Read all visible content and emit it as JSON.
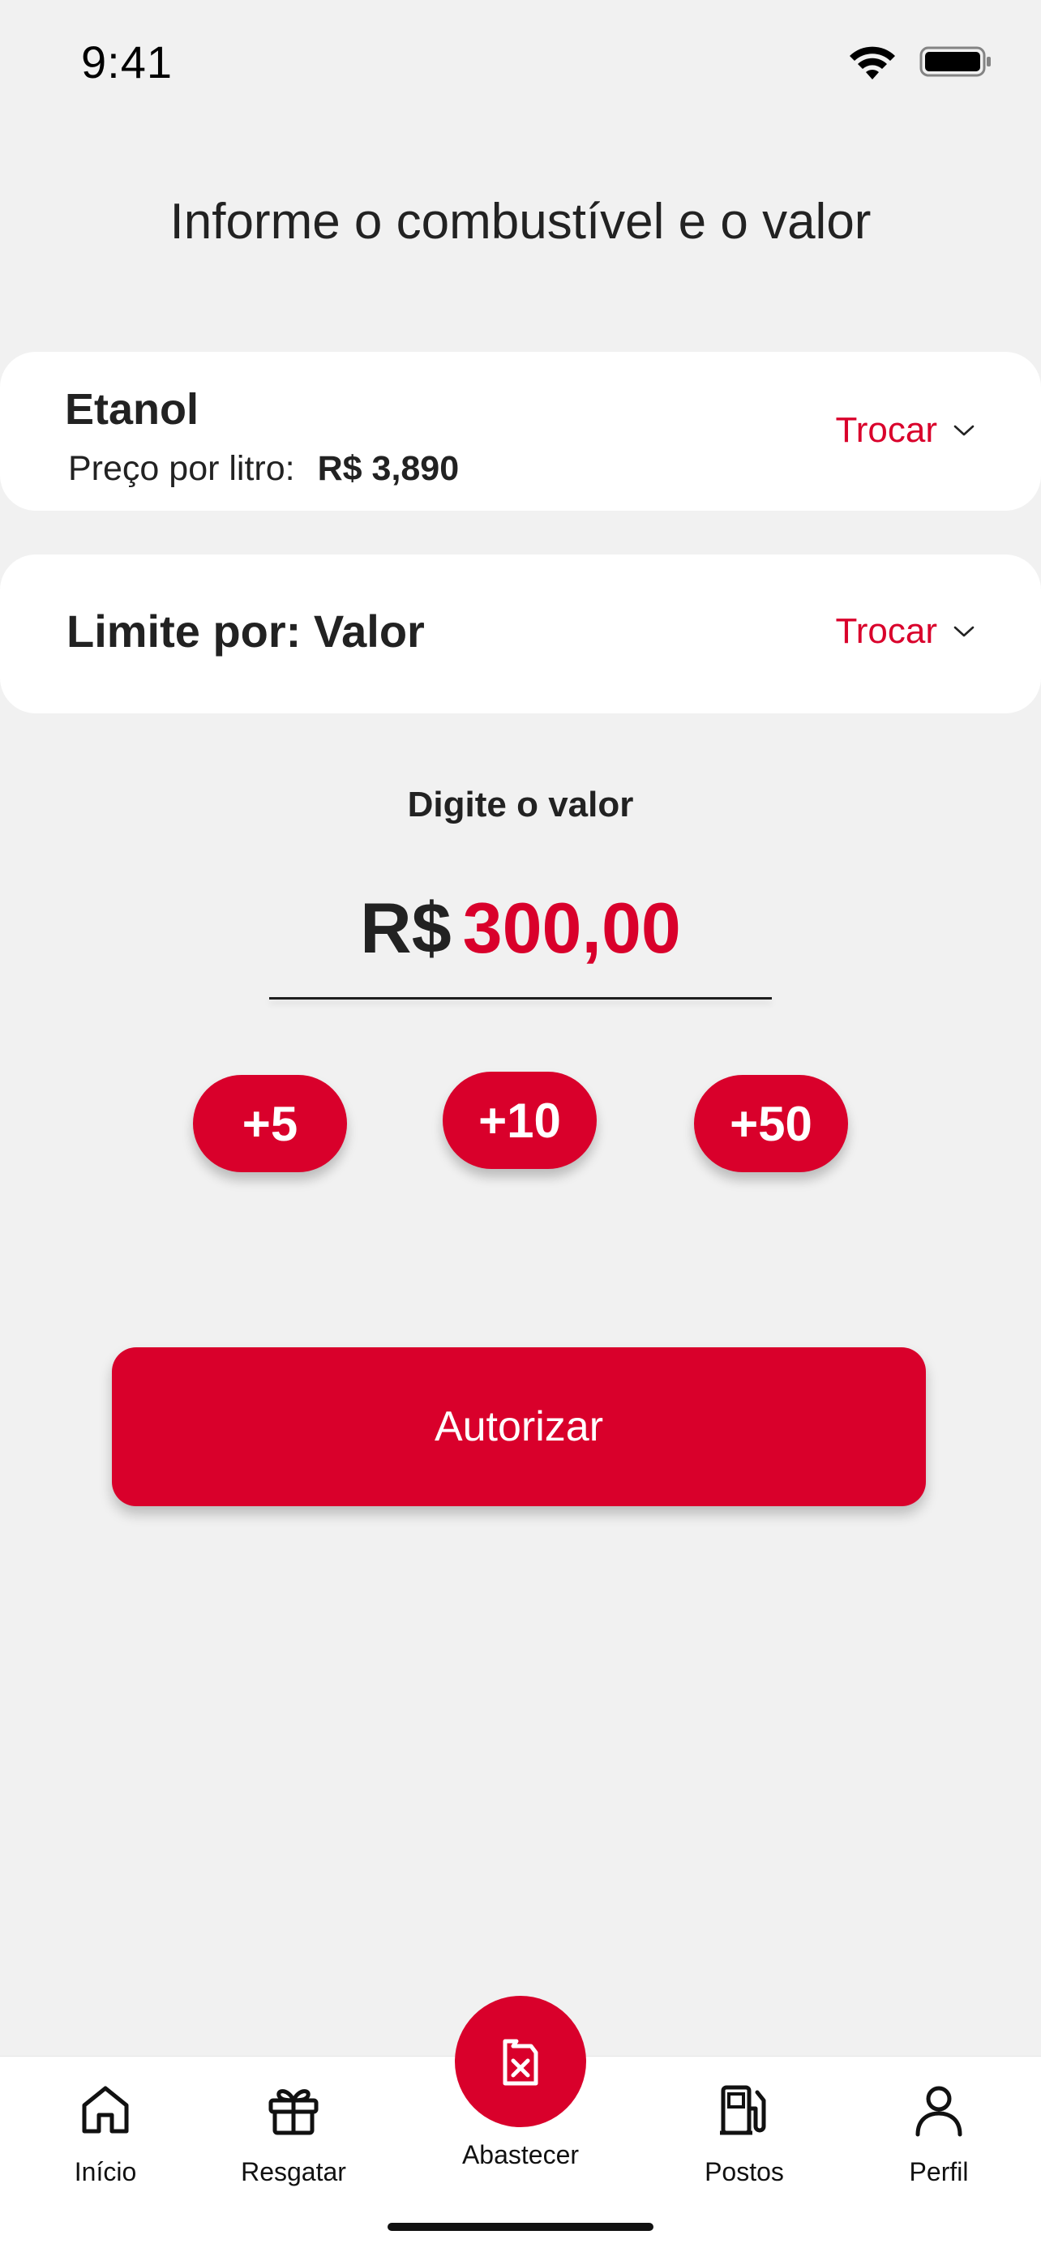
{
  "status_bar": {
    "time": "9:41"
  },
  "page": {
    "title": "Informe o combustível e o valor"
  },
  "fuel_card": {
    "fuel_name": "Etanol",
    "price_label": "Preço por litro:",
    "price_value": "R$ 3,890",
    "change_label": "Trocar"
  },
  "limit_card": {
    "label": "Limite por: Valor",
    "change_label": "Trocar"
  },
  "value_entry": {
    "caption": "Digite o valor",
    "currency": "R$",
    "amount": "300,00"
  },
  "quick_add": [
    "+5",
    "+10",
    "+50"
  ],
  "authorize_label": "Autorizar",
  "tabs": {
    "inicio": {
      "label": "Início",
      "icon": "home-icon"
    },
    "resgatar": {
      "label": "Resgatar",
      "icon": "gift-icon"
    },
    "abastecer": {
      "label": "Abastecer",
      "icon": "fuel-can-icon"
    },
    "postos": {
      "label": "Postos",
      "icon": "gas-station-icon"
    },
    "perfil": {
      "label": "Perfil",
      "icon": "user-icon"
    }
  },
  "colors": {
    "accent": "#d9002b",
    "background": "#f1f1f1",
    "card": "#ffffff",
    "text": "#222222"
  }
}
